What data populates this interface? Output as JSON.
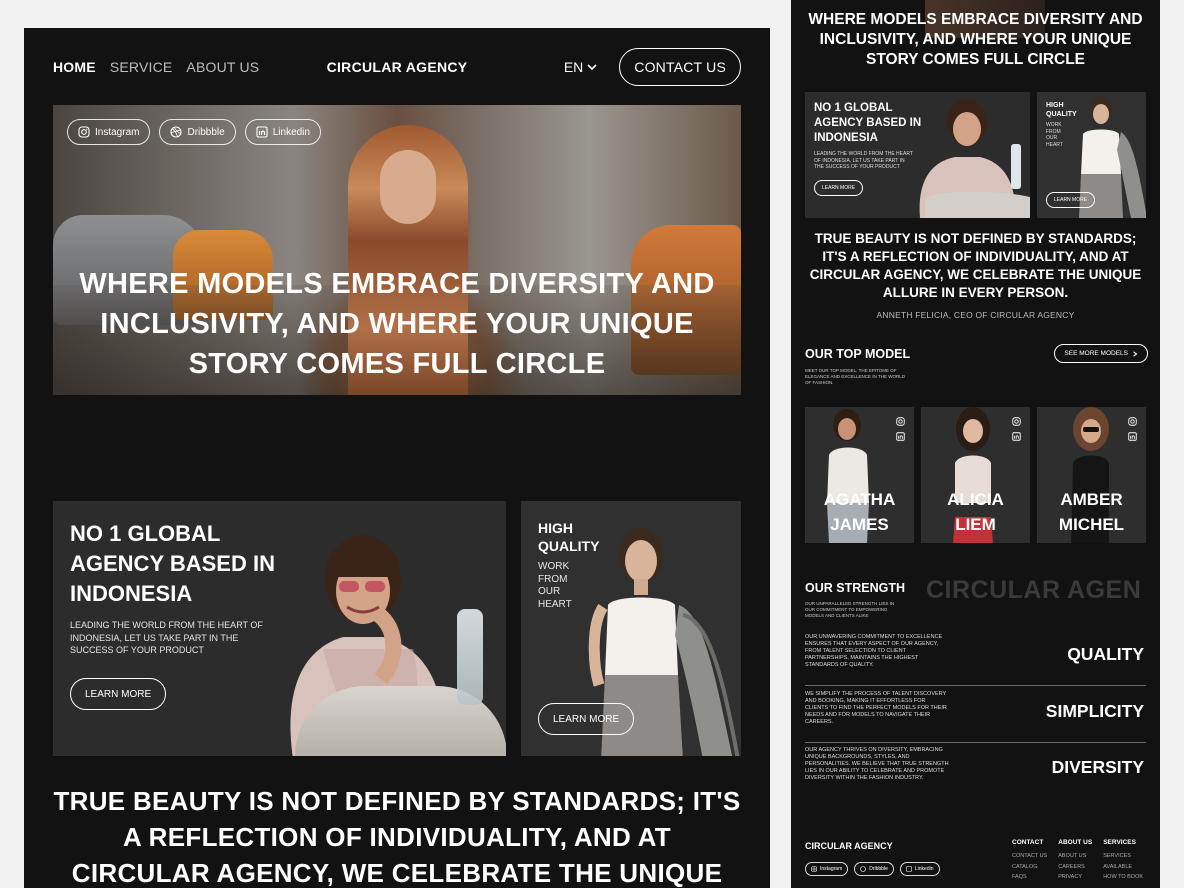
{
  "desktop": {
    "nav": {
      "links": [
        "HOME",
        "SERVICE",
        "ABOUT US"
      ],
      "brand": "CIRCULAR AGENCY",
      "language": "EN",
      "contact_label": "CONTACT US"
    },
    "hero": {
      "socials": [
        "Instagram",
        "Dribbble",
        "Linkedin"
      ],
      "heading": "WHERE MODELS EMBRACE DIVERSITY AND INCLUSIVITY, AND WHERE YOUR UNIQUE STORY COMES FULL CIRCLE"
    },
    "feature_card": {
      "title": "NO 1 GLOBAL AGENCY BASED IN INDONESIA",
      "text": "LEADING THE WORLD FROM THE HEART OF INDONESIA, LET US TAKE PART IN THE SUCCESS OF YOUR PRODUCT",
      "button": "LEARN MORE"
    },
    "quality_card": {
      "title": "HIGH QUALITY",
      "text": "WORK FROM OUR HEART",
      "button": "LEARN MORE"
    },
    "quote": "TRUE BEAUTY IS NOT DEFINED BY STANDARDS; IT'S A REFLECTION OF INDIVIDUALITY, AND AT CIRCULAR AGENCY, WE CELEBRATE THE UNIQUE"
  },
  "mobile": {
    "hero_heading": "WHERE MODELS EMBRACE DIVERSITY AND INCLUSIVITY, AND WHERE YOUR UNIQUE STORY COMES FULL CIRCLE",
    "feature_card": {
      "title": "NO 1 GLOBAL AGENCY BASED IN INDONESIA",
      "text": "LEADING THE WORLD FROM THE HEART OF INDONESIA, LET US TAKE PART IN THE SUCCESS OF YOUR PRODUCT",
      "button": "LEARN MORE"
    },
    "quality_card": {
      "title": "HIGH QUALITY",
      "text": "WORK FROM OUR HEART",
      "button": "LEARN MORE"
    },
    "quote": "TRUE BEAUTY IS NOT DEFINED BY STANDARDS; IT'S A REFLECTION OF INDIVIDUALITY, AND AT CIRCULAR AGENCY, WE CELEBRATE THE UNIQUE ALLURE IN EVERY PERSON.",
    "quote_author": "ANNETH FELICIA, CEO OF CIRCULAR AGENCY",
    "top_model": {
      "title": "OUR TOP MODEL",
      "desc": "MEET OUR TOP MODEL, THE EPITOME OF ELEGANCE AND EXCELLENCE IN THE WORLD OF FASHION.",
      "see_more": "SEE MORE MODELS",
      "models": [
        {
          "first": "AGATHA",
          "last": "JAMES"
        },
        {
          "first": "ALICIA",
          "last": "LIEM"
        },
        {
          "first": "AMBER",
          "last": "MICHEL"
        }
      ]
    },
    "strength": {
      "title": "OUR STRENGTH",
      "desc": "OUR UNPARALLELED STRENGTH LIES IN OUR COMMITMENT TO EMPOWERING MODELS AND CLIENTS ALIKE",
      "marquee": "CIRCULAR AGEN",
      "items": [
        {
          "label": "QUALITY",
          "text": "OUR UNWAVERING COMMITMENT TO EXCELLENCE ENSURES THAT EVERY ASPECT OF OUR AGENCY, FROM TALENT SELECTION TO CLIENT PARTNERSHIPS, MAINTAINS THE HIGHEST STANDARDS OF QUALITY."
        },
        {
          "label": "SIMPLICITY",
          "text": "WE SIMPLIFY THE PROCESS OF TALENT DISCOVERY AND BOOKING, MAKING IT EFFORTLESS FOR CLIENTS TO FIND THE PERFECT MODELS FOR THEIR NEEDS AND FOR MODELS TO NAVIGATE THEIR CAREERS."
        },
        {
          "label": "DIVERSITY",
          "text": "OUR AGENCY THRIVES ON DIVERSITY, EMBRACING UNIQUE BACKGROUNDS, STYLES, AND PERSONALITIES. WE BELIEVE THAT TRUE STRENGTH LIES IN OUR ABILITY TO CELEBRATE AND PROMOTE DIVERSITY WITHIN THE FASHION INDUSTRY."
        }
      ]
    },
    "footer": {
      "brand": "CIRCULAR AGENCY",
      "socials": [
        "Instagram",
        "Dribbble",
        "Linkedin"
      ],
      "columns": [
        {
          "title": "CONTACT",
          "items": [
            "CONTACT US",
            "CATALOG",
            "FAQS"
          ]
        },
        {
          "title": "ABOUT US",
          "items": [
            "ABOUT US",
            "CAREERS",
            "PRIVACY"
          ]
        },
        {
          "title": "SERVICES",
          "items": [
            "SERVICES",
            "AVAILABLE",
            "HOW TO BOOK"
          ]
        }
      ]
    }
  }
}
